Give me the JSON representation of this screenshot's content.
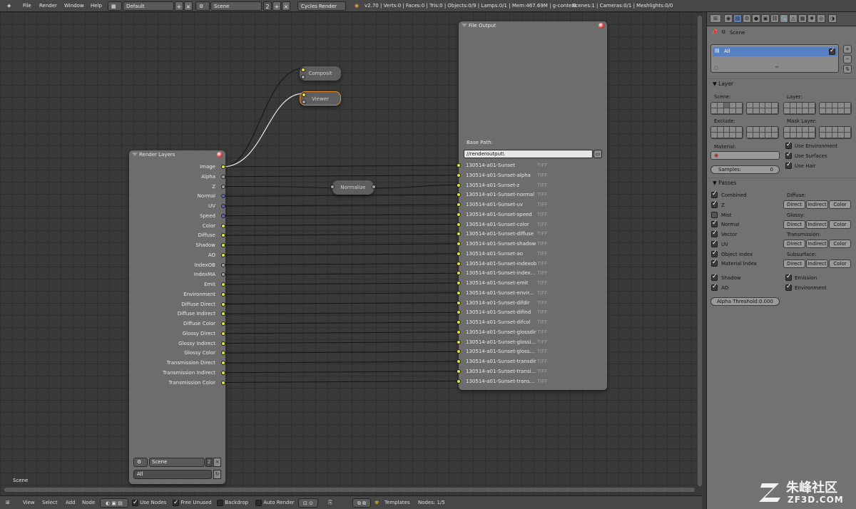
{
  "topbar": {
    "menus": [
      "File",
      "Render",
      "Window",
      "Help"
    ],
    "layout": "Default",
    "scene": "Scene",
    "scene_users": "2",
    "engine": "Cycles Render",
    "stats": "v2.70 | Verts:0 | Faces:0 | Tris:0 | Objects:0/9 | Lamps:0/1 | Mem:467.69M | g-context",
    "scenes": "Scenes:1 | Cameras:0/1 | Meshlights:0/0"
  },
  "nodes": {
    "composite": "Composit",
    "viewer": "Viewer",
    "normalize": "Normalize",
    "render_layers": {
      "title": "Render Layers",
      "outputs": [
        "Image",
        "Alpha",
        "Z",
        "Normal",
        "UV",
        "Speed",
        "Color",
        "Diffuse",
        "Shadow",
        "AO",
        "IndexOB",
        "IndexMA",
        "Emit",
        "Environment",
        "Diffuse Direct",
        "Diffuse Indirect",
        "Diffuse Color",
        "Glossy Direct",
        "Glossy Indirect",
        "Glossy Color",
        "Transmission Direct",
        "Transmission Indirect",
        "Transmission Color"
      ],
      "scene": "Scene",
      "scene_users": "2",
      "layer": "All"
    },
    "file_output": {
      "title": "File Output",
      "base_path_label": "Base Path:",
      "base_path": "//renderoutput\\",
      "format": "TIFF",
      "inputs": [
        "130514-a01-Sunset",
        "130514-a01-Sunset-alpha",
        "130514-a01-Sunset-z",
        "130514-a01-Sunset-normal",
        "130514-a01-Sunset-uv",
        "130514-a01-Sunset-speed",
        "130514-a01-Sunset-color",
        "130514-a01-Sunset-diffuse",
        "130514-a01-Sunset-shadow",
        "130514-a01-Sunset-ao",
        "130514-a01-Sunset-indexob",
        "130514-a01-Sunset-index...",
        "130514-a01-Sunset-emit",
        "130514-a01-Sunset-envir...",
        "130514-a01-Sunset-difdir",
        "130514-a01-Sunset-difind",
        "130514-a01-Sunset-difcol",
        "130514-a01-Sunset-glossdir",
        "130514-a01-Sunset-glossi...",
        "130514-a01-Sunset-gloss...",
        "130514-a01-Sunset-transdir",
        "130514-a01-Sunset-transi...",
        "130514-a01-Sunset-trans..."
      ]
    }
  },
  "editor": {
    "scene_label": "Scene"
  },
  "bottombar": {
    "menus": [
      "View",
      "Select",
      "Add",
      "Node"
    ],
    "use_nodes": "Use Nodes",
    "free_unused": "Free Unused",
    "backdrop": "Backdrop",
    "auto_render": "Auto Render",
    "templates": "Templates",
    "nodes_count": "Nodes: 1/5"
  },
  "props": {
    "context": "Scene",
    "layer_item": "All",
    "layer_panel": {
      "title": "Layer",
      "scene": "Scene:",
      "layer": "Layer:",
      "exclude": "Exclude:",
      "mask_layer": "Mask Layer:",
      "material": "Material:",
      "samples": "Samples:",
      "samples_value": "0",
      "use_environment": "Use Environment",
      "use_surfaces": "Use Surfaces",
      "use_hair": "Use Hair"
    },
    "passes_panel": {
      "title": "Passes",
      "left": [
        {
          "label": "Combined",
          "on": true
        },
        {
          "label": "Z",
          "on": true
        },
        {
          "label": "Mist",
          "on": false
        },
        {
          "label": "Normal",
          "on": true
        },
        {
          "label": "Vector",
          "on": true
        },
        {
          "label": "UV",
          "on": true
        },
        {
          "label": "Object Index",
          "on": true
        },
        {
          "label": "Material Index",
          "on": true
        }
      ],
      "groups": [
        "Diffuse:",
        "Glossy:",
        "Transmission:",
        "Subsurface:"
      ],
      "direct": "Direct",
      "indirect": "Indirect",
      "color": "Color",
      "shadow": "Shadow",
      "ao": "AO",
      "emission": "Emission",
      "environment": "Environment",
      "alpha_threshold": "Alpha Threshold:",
      "alpha_threshold_value": "0.000"
    }
  },
  "watermark": {
    "cn": "朱峰社区",
    "url": "ZF3D.COM"
  }
}
